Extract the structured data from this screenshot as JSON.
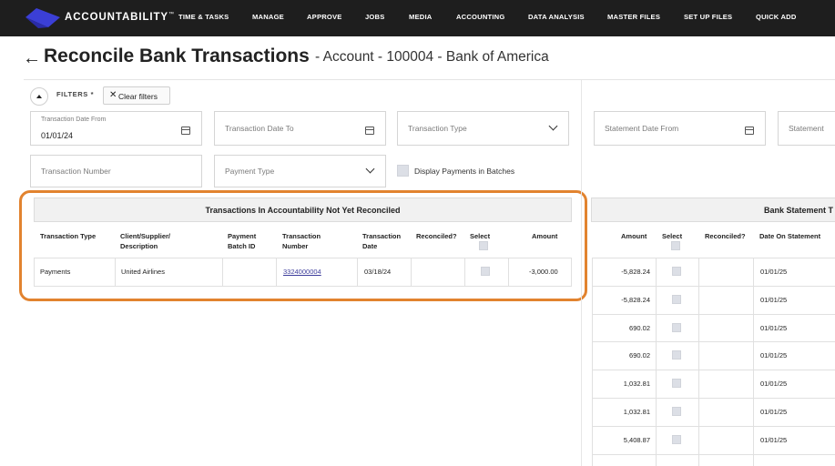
{
  "nav": {
    "brand": "ACCOUNTABILITY",
    "brand_tm": "™",
    "items": [
      "TIME & TASKS",
      "MANAGE",
      "APPROVE",
      "JOBS",
      "MEDIA",
      "ACCOUNTING",
      "DATA ANALYSIS",
      "MASTER FILES",
      "SET UP FILES",
      "QUICK ADD"
    ],
    "bg_color": "#1e1e1e",
    "logo_color": "#3b3fd6"
  },
  "header": {
    "back_icon": "arrow-left-icon",
    "title": "Reconcile Bank Transactions",
    "subtitle": "- Account - 100004 - Bank of America"
  },
  "filters": {
    "label": "FILTERS *",
    "clear_label": "Clear filters",
    "transaction_date_from": {
      "label": "Transaction Date From",
      "value": "01/01/24"
    },
    "transaction_date_to": {
      "placeholder": "Transaction Date To"
    },
    "transaction_type": {
      "placeholder": "Transaction Type"
    },
    "statement_date_from": {
      "placeholder": "Statement Date From"
    },
    "statement_date_to": {
      "placeholder": "Statement"
    },
    "transaction_number": {
      "placeholder": "Transaction Number"
    },
    "payment_type": {
      "placeholder": "Payment Type"
    },
    "display_batches": {
      "label": "Display Payments in Batches",
      "checked": false
    }
  },
  "left_table": {
    "title": "Transactions In Accountability Not Yet Reconciled",
    "columns": [
      "Transaction Type",
      "Client/Supplier/ Description",
      "Payment Batch ID",
      "Transaction Number",
      "Transaction Date",
      "Reconciled?",
      "Select",
      "Amount"
    ],
    "rows": [
      {
        "type": "Payments",
        "client": "United Airlines",
        "batch": "",
        "number": "3324000004",
        "date": "03/18/24",
        "reconciled": "",
        "amount": "-3,000.00"
      }
    ]
  },
  "right_table": {
    "title": "Bank Statement T",
    "columns": [
      "Amount",
      "Select",
      "Reconciled?",
      "Date On Statement"
    ],
    "rows": [
      {
        "amount": "-5,828.24",
        "date": "01/01/25"
      },
      {
        "amount": "-5,828.24",
        "date": "01/01/25"
      },
      {
        "amount": "690.02",
        "date": "01/01/25"
      },
      {
        "amount": "690.02",
        "date": "01/01/25"
      },
      {
        "amount": "1,032.81",
        "date": "01/01/25"
      },
      {
        "amount": "1,032.81",
        "date": "01/01/25"
      },
      {
        "amount": "5,408.87",
        "date": "01/01/25"
      }
    ]
  },
  "highlight_color": "#e2832f"
}
